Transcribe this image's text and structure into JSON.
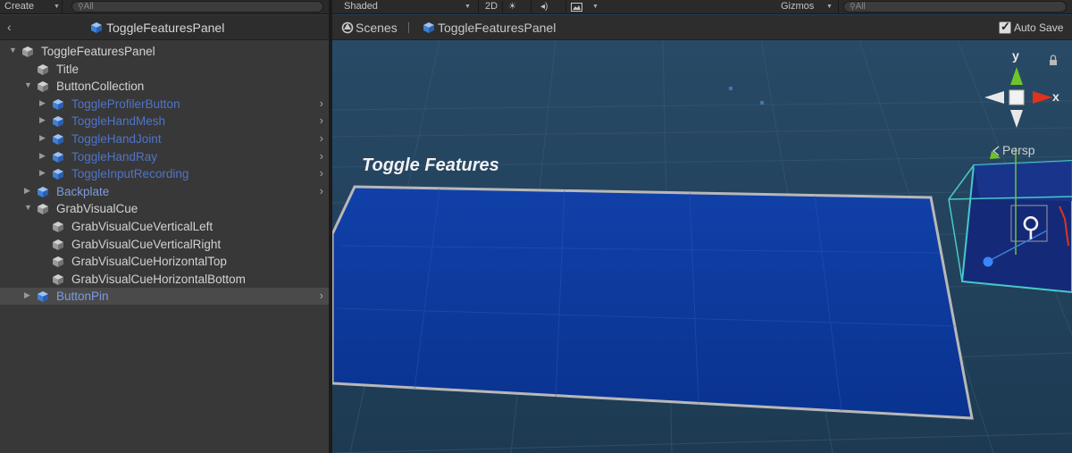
{
  "hierarchy": {
    "toolbar": {
      "create_label": "Create",
      "search_placeholder": "All"
    },
    "header_title": "ToggleFeaturesPanel",
    "items": [
      {
        "label": "ToggleFeaturesPanel"
      },
      {
        "label": "Title"
      },
      {
        "label": "ButtonCollection"
      },
      {
        "label": "ToggleProfilerButton"
      },
      {
        "label": "ToggleHandMesh"
      },
      {
        "label": "ToggleHandJoint"
      },
      {
        "label": "ToggleHandRay"
      },
      {
        "label": "ToggleInputRecording"
      },
      {
        "label": "Backplate"
      },
      {
        "label": "GrabVisualCue"
      },
      {
        "label": "GrabVisualCueVerticalLeft"
      },
      {
        "label": "GrabVisualCueVerticalRight"
      },
      {
        "label": "GrabVisualCueHorizontalTop"
      },
      {
        "label": "GrabVisualCueHorizontalBottom"
      },
      {
        "label": "ButtonPin"
      }
    ]
  },
  "scene": {
    "toolbar": {
      "shading_mode": "Shaded",
      "mode_2d": "2D",
      "gizmos_label": "Gizmos",
      "search_placeholder": "All"
    },
    "breadcrumb": {
      "root": "Scenes",
      "current": "ToggleFeaturesPanel"
    },
    "auto_save_label": "Auto Save",
    "auto_save_checked": true,
    "panel_title": "Toggle Features",
    "gizmo": {
      "x_label": "x",
      "y_label": "y",
      "projection_label": "Persp"
    }
  },
  "colors": {
    "viewport_bg": "#224059",
    "panel_fill": "#0d3a9a",
    "prefab_text": "#7d9ae0",
    "gizmo_x": "#e2321b",
    "gizmo_y": "#6ec42a"
  },
  "icons": [
    "cube-icon",
    "prefab-cube-icon",
    "lock-icon",
    "sun-icon",
    "audio-icon",
    "image-icon",
    "chevron-right-icon",
    "fold-arrow-icon",
    "checkbox-icon",
    "pin-icon"
  ]
}
